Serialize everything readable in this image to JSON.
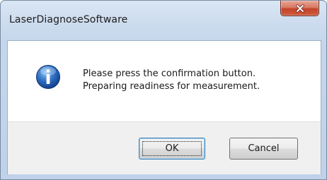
{
  "window": {
    "title": "LaserDiagnoseSoftware"
  },
  "titlebar": {
    "close_icon": "close-icon"
  },
  "message": {
    "icon": "info-icon",
    "line1": "Please press the confirmation button.",
    "line2": "Preparing readiness for measurement."
  },
  "buttons": {
    "ok_label": "OK",
    "cancel_label": "Cancel"
  },
  "colors": {
    "close_button": "#c7432a",
    "info_icon": "#2f6fc6",
    "button_bar": "#f0f0f0"
  }
}
